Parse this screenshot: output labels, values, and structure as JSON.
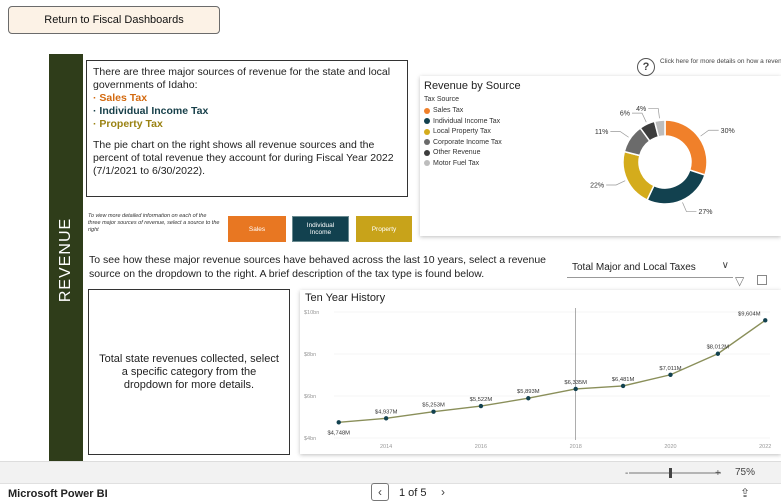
{
  "top": {
    "return_label": "Return to Fiscal Dashboards"
  },
  "side_band": {
    "label": "REVENUE"
  },
  "intro": {
    "line1": "There are three major sources of revenue for the state and local governments of Idaho:",
    "sources": [
      "· Sales Tax",
      "· Individual Income Tax",
      "· Property Tax"
    ],
    "line2": "The pie chart on the right shows all revenue sources and the percent of total revenue they account for during Fiscal Year 2022 (7/1/2021 to 6/30/2022)."
  },
  "help": {
    "icon": "question-icon",
    "text": "Click here for more details on how a revenues are distribute"
  },
  "pie": {
    "title": "Revenue by Source",
    "legend_title": "Tax Source"
  },
  "hint": "To view more detailed information on each of the three major sources of revenue, select a source to the right",
  "buttons": {
    "sales": "Sales",
    "income_line1": "Individual",
    "income_line2": "Income",
    "property": "Property"
  },
  "see_text": "To see how these major revenue sources have behaved across the last 10 years, select a revenue source on the dropdown to the right. A brief description of the tax type is found below.",
  "dropdown": {
    "value": "Total Major and Local Taxes"
  },
  "description": "Total state revenues collected, select a specific category from the dropdown for more details.",
  "history": {
    "title": "Ten Year History"
  },
  "status": {
    "zoom": "75%"
  },
  "footer": {
    "brand": "Microsoft Power BI",
    "page": "1 of 5"
  },
  "colors": {
    "band": "#2f3d1a",
    "sales": "#e87722",
    "income": "#12414f",
    "property": "#c8a31a"
  },
  "chart_data": [
    {
      "type": "pie",
      "title": "Revenue by Source",
      "legend_title": "Tax Source",
      "categories": [
        "Sales Tax",
        "Individual Income Tax",
        "Local Property Tax",
        "Corporate Income Tax",
        "Other Revenue",
        "Motor Fuel Tax"
      ],
      "values": [
        30,
        27,
        22,
        11,
        6,
        4
      ],
      "labels": [
        "30%",
        "27%",
        "22%",
        "11%",
        "6%",
        "4%"
      ],
      "colors": [
        "#f0802a",
        "#12414f",
        "#d4ac1c",
        "#6b6b6b",
        "#3d3d3d",
        "#bdbdbd"
      ],
      "legend_position": "left"
    },
    {
      "type": "line",
      "title": "Ten Year History",
      "x": [
        2013,
        2014,
        2015,
        2016,
        2017,
        2018,
        2019,
        2020,
        2021,
        2022
      ],
      "values": [
        4.748,
        4.937,
        5.253,
        5.522,
        5.893,
        6.335,
        6.481,
        7.011,
        8.012,
        9.604
      ],
      "data_labels": [
        "$4,748M",
        "$4,937M",
        "$5,253M",
        "$5,522M",
        "$5,893M",
        "$6,335M",
        "$6,481M",
        "$7,011M",
        "$8,012M",
        "$9,604M"
      ],
      "y_ticks": [
        "$4bn",
        "$6bn",
        "$8bn",
        "$10bn"
      ],
      "x_ticks": [
        "2014",
        "2016",
        "2018",
        "2020",
        "2022"
      ],
      "ylim": [
        4,
        10
      ],
      "line_color": "#8a8f5a"
    }
  ]
}
